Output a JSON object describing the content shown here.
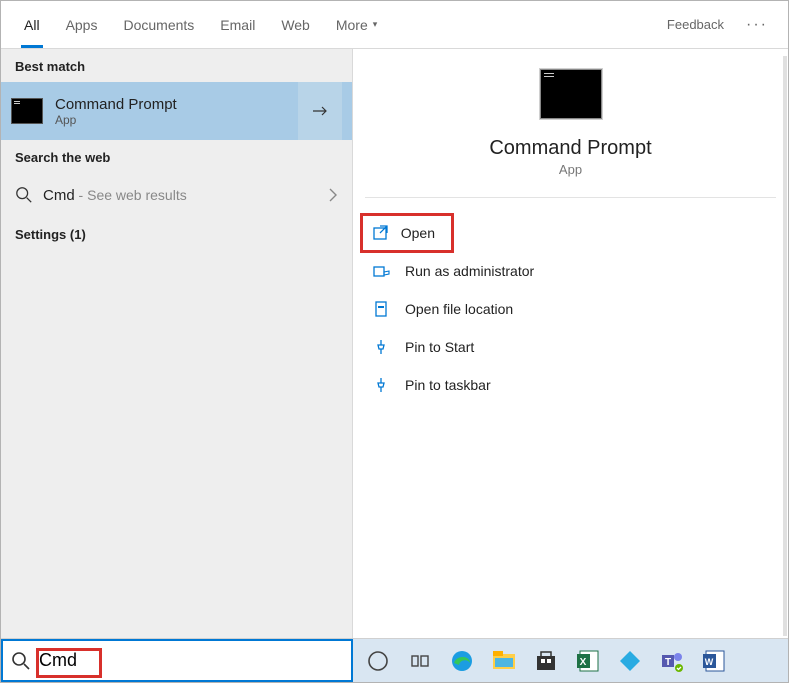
{
  "tabs": [
    "All",
    "Apps",
    "Documents",
    "Email",
    "Web",
    "More"
  ],
  "feedback": "Feedback",
  "left": {
    "best_match_header": "Best match",
    "best_match_title": "Command Prompt",
    "best_match_sub": "App",
    "search_web_header": "Search the web",
    "web_query": "Cmd",
    "web_sub": " - See web results",
    "settings_header": "Settings (1)"
  },
  "right": {
    "title": "Command Prompt",
    "sub": "App",
    "actions": [
      "Open",
      "Run as administrator",
      "Open file location",
      "Pin to Start",
      "Pin to taskbar"
    ]
  },
  "search_value": "Cmd"
}
